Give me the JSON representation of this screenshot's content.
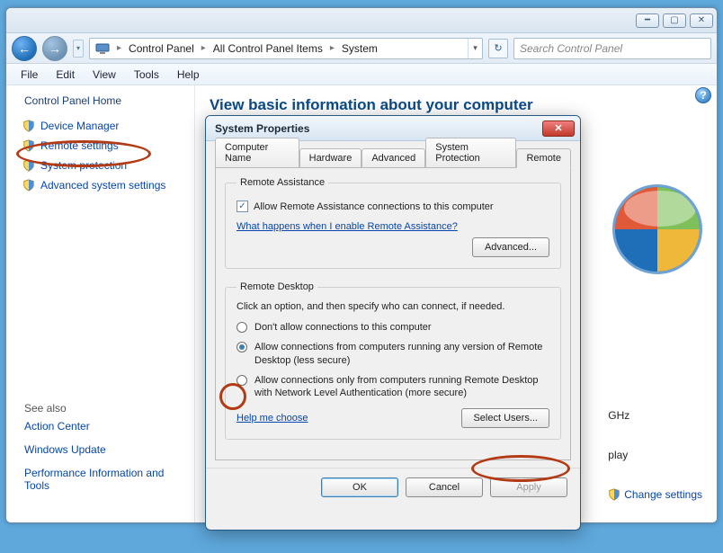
{
  "window": {
    "breadcrumb": [
      "Control Panel",
      "All Control Panel Items",
      "System"
    ],
    "search_placeholder": "Search Control Panel",
    "menus": [
      "File",
      "Edit",
      "View",
      "Tools",
      "Help"
    ]
  },
  "sidebar": {
    "home": "Control Panel Home",
    "links": [
      {
        "label": "Device Manager",
        "shield": true
      },
      {
        "label": "Remote settings",
        "shield": true,
        "highlighted": true
      },
      {
        "label": "System protection",
        "shield": true
      },
      {
        "label": "Advanced system settings",
        "shield": true
      }
    ],
    "see_also_header": "See also",
    "see_also": [
      "Action Center",
      "Windows Update",
      "Performance Information and Tools"
    ]
  },
  "main": {
    "title": "View basic information about your computer",
    "right_col": {
      "ghz": "GHz",
      "play": "play"
    },
    "change_settings": "Change settings"
  },
  "dialog": {
    "title": "System Properties",
    "tabs": [
      "Computer Name",
      "Hardware",
      "Advanced",
      "System Protection",
      "Remote"
    ],
    "active_tab": "Remote",
    "remote_assistance": {
      "legend": "Remote Assistance",
      "checkbox_label": "Allow Remote Assistance connections to this computer",
      "checked": true,
      "help_link": "What happens when I enable Remote Assistance?",
      "advanced_btn": "Advanced..."
    },
    "remote_desktop": {
      "legend": "Remote Desktop",
      "desc": "Click an option, and then specify who can connect, if needed.",
      "options": [
        "Don't allow connections to this computer",
        "Allow connections from computers running any version of Remote Desktop (less secure)",
        "Allow connections only from computers running Remote Desktop with Network Level Authentication (more secure)"
      ],
      "selected_index": 1,
      "help_link": "Help me choose",
      "select_users_btn": "Select Users..."
    },
    "buttons": {
      "ok": "OK",
      "cancel": "Cancel",
      "apply": "Apply"
    }
  }
}
